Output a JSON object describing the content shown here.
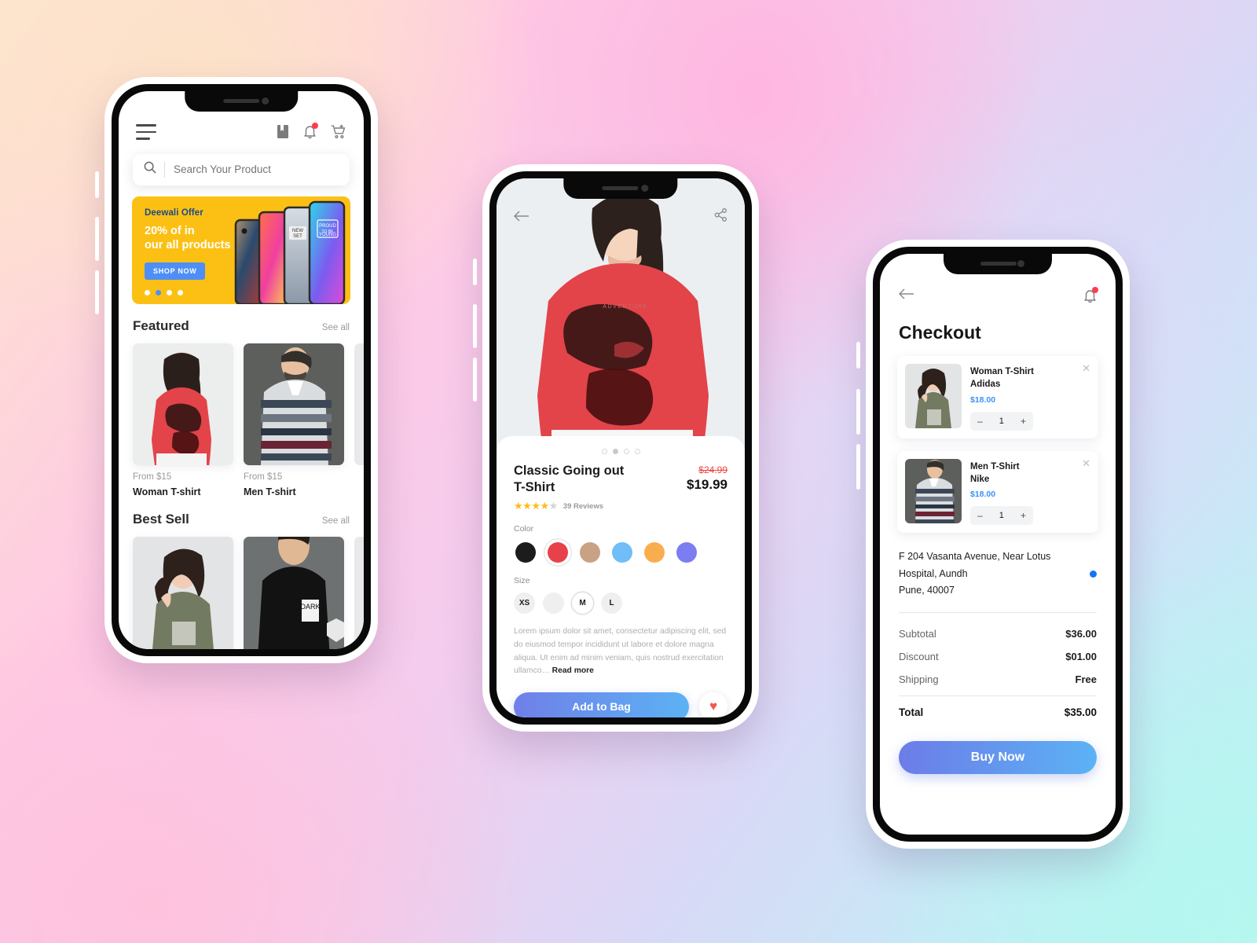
{
  "background": {
    "colors": [
      "#fde6cf",
      "#ffc9e4",
      "#f3ccee",
      "#d8d9f6",
      "#c7e9f7",
      "#b8f5ef"
    ]
  },
  "accent": {
    "blue": "#3b93f7",
    "gradient_start": "#6c7ce8",
    "gradient_end": "#5cb2f5",
    "yellow": "#fcc014",
    "red": "#f0453c"
  },
  "home": {
    "menu_icon": "hamburger-menu-icon",
    "icons": [
      {
        "name": "bookmark-icon",
        "label": "Bookmarks"
      },
      {
        "name": "notification-bell-icon",
        "label": "Notifications",
        "has_badge": true
      },
      {
        "name": "add-to-cart-icon",
        "label": "Cart"
      }
    ],
    "search": {
      "placeholder": "Search Your Product",
      "value": "",
      "icon": "search-icon"
    },
    "banner": {
      "title": "Deewali Offer",
      "subtitle_line1": "20% of in",
      "subtitle_line2": "our all products",
      "cta": "SHOP NOW",
      "dots": 4,
      "active_dot": 1,
      "bg": "#fcc014"
    },
    "sections": [
      {
        "title": "Featured",
        "see_all": "See all",
        "products": [
          {
            "price": "From $15",
            "name": "Woman T-shirt"
          },
          {
            "price": "From $15",
            "name": "Men T-shirt"
          }
        ]
      },
      {
        "title": "Best Sell",
        "see_all": "See all",
        "products": [
          {
            "price": "",
            "name": ""
          },
          {
            "price": "",
            "name": ""
          }
        ]
      }
    ]
  },
  "detail": {
    "back_icon": "back-arrow-icon",
    "share_icon": "share-icon",
    "gallery": {
      "dots": 4,
      "active_dot": 1
    },
    "product_name_line1": "Classic Going out",
    "product_name_line2": "T-Shirt",
    "old_price": "$24.99",
    "new_price": "$19.99",
    "rating": 4,
    "rating_max": 5,
    "reviews": "39 Reviews",
    "color_label": "Color",
    "colors": [
      {
        "name": "black",
        "hex": "#1c1c1c",
        "selected": false
      },
      {
        "name": "red",
        "hex": "#e8414a",
        "selected": true
      },
      {
        "name": "tan",
        "hex": "#c9a184",
        "selected": false
      },
      {
        "name": "sky-blue",
        "hex": "#70bdf7",
        "selected": false
      },
      {
        "name": "orange",
        "hex": "#f9ae4d",
        "selected": false
      },
      {
        "name": "periwinkle",
        "hex": "#7b7df0",
        "selected": false
      }
    ],
    "size_label": "Size",
    "sizes": [
      {
        "label": "XS",
        "selected": false
      },
      {
        "label": "",
        "selected": false
      },
      {
        "label": "M",
        "selected": true
      },
      {
        "label": "L",
        "selected": false
      }
    ],
    "description": "Lorem ipsum dolor sit amet, consectetur adipiscing elit, sed do eiusmod tempor incididunt ut labore et dolore magna aliqua. Ut enim ad minim veniam, quis nostrud exercitation ullamco…",
    "read_more": "Read more",
    "add_to_bag": "Add to Bag",
    "wishlist_icon": "heart-icon"
  },
  "checkout": {
    "back_icon": "back-arrow-icon",
    "bell_icon": "notification-bell-icon",
    "title": "Checkout",
    "items": [
      {
        "name": "Woman T-Shirt",
        "brand": "Adidas",
        "price": "$18.00",
        "qty": "1",
        "minus": "–",
        "plus": "+",
        "remove": "✕"
      },
      {
        "name": "Men T-Shirt",
        "brand": "Nike",
        "price": "$18.00",
        "qty": "1",
        "minus": "–",
        "plus": "+",
        "remove": "✕"
      }
    ],
    "address_line1": "F 204 Vasanta Avenue, Near Lotus",
    "address_line2": "Hospital, Aundh",
    "address_line3": "Pune, 40007",
    "totals": [
      {
        "key": "Subtotal",
        "value": "$36.00"
      },
      {
        "key": "Discount",
        "value": "$01.00"
      },
      {
        "key": "Shipping",
        "value": "Free"
      }
    ],
    "grand_total": {
      "key": "Total",
      "value": "$35.00"
    },
    "buy_now": "Buy Now"
  }
}
